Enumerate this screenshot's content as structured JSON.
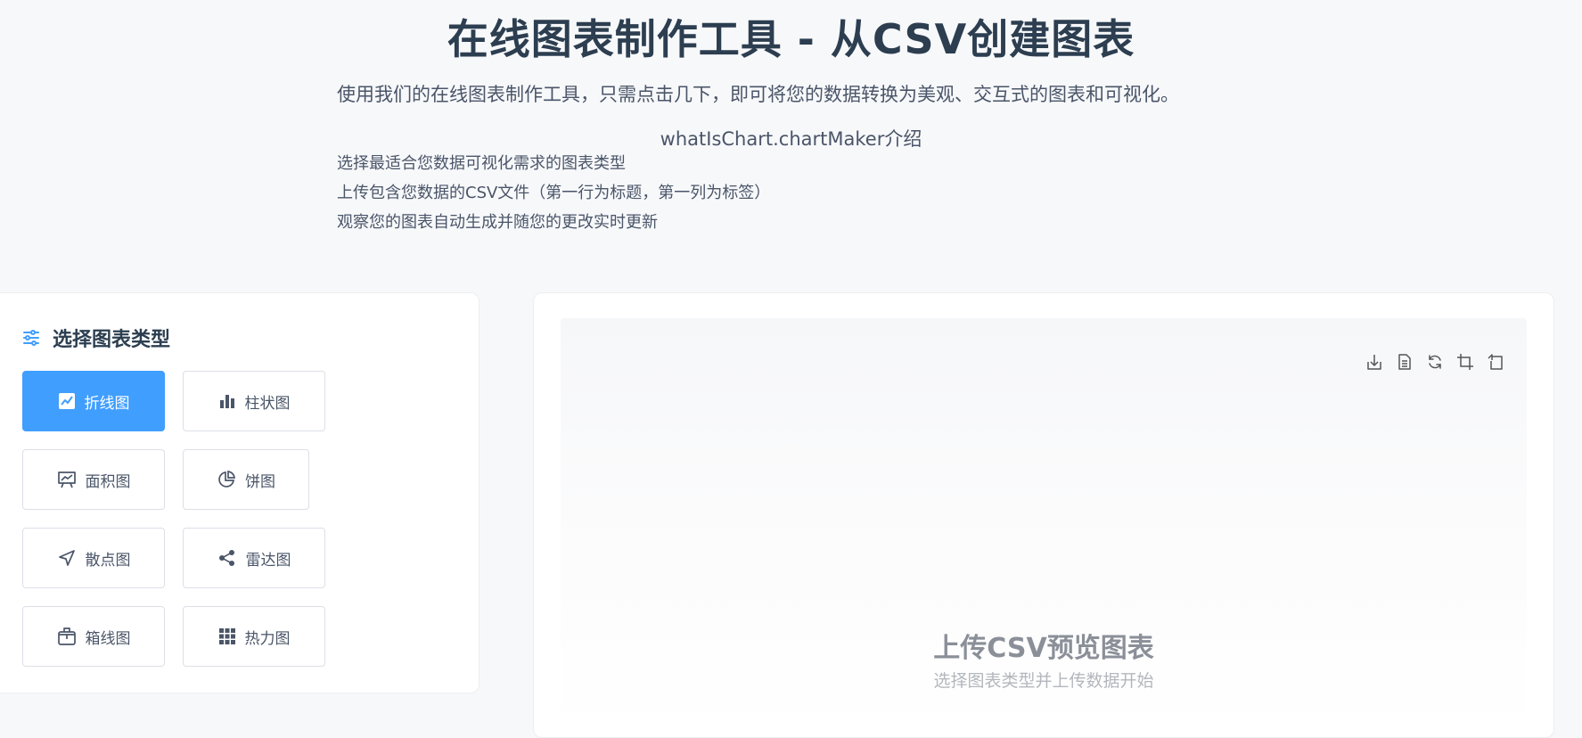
{
  "header": {
    "title": "在线图表制作工具 - 从CSV创建图表",
    "subtitle": "使用我们的在线图表制作工具，只需点击几下，即可将您的数据转换为美观、交互式的图表和可视化。",
    "intro_heading": "whatIsChart.chartMaker介绍",
    "steps": [
      "选择最适合您数据可视化需求的图表类型",
      "上传包含您数据的CSV文件（第一行为标题，第一列为标签）",
      "观察您的图表自动生成并随您的更改实时更新"
    ]
  },
  "chart_types_panel": {
    "title": "选择图表类型",
    "icon": "sliders-icon",
    "selected": "折线图",
    "types": [
      {
        "label": "折线图",
        "icon": "line-chart-icon",
        "active": true
      },
      {
        "label": "柱状图",
        "icon": "bar-chart-icon",
        "active": false
      },
      {
        "label": "面积图",
        "icon": "area-chart-icon",
        "active": false
      },
      {
        "label": "饼图",
        "icon": "pie-chart-icon",
        "active": false
      },
      {
        "label": "散点图",
        "icon": "scatter-icon",
        "active": false
      },
      {
        "label": "雷达图",
        "icon": "radar-share-icon",
        "active": false
      },
      {
        "label": "箱线图",
        "icon": "boxplot-icon",
        "active": false
      },
      {
        "label": "热力图",
        "icon": "heatmap-grid-icon",
        "active": false
      }
    ]
  },
  "preview": {
    "placeholder_title": "上传CSV预览图表",
    "placeholder_subtitle": "选择图表类型并上传数据开始",
    "toolbox": [
      "save-image-icon",
      "data-view-icon",
      "restore-icon",
      "zoom-icon",
      "zoom-reset-icon"
    ]
  },
  "colors": {
    "accent": "#409eff",
    "title": "#2c3e50",
    "text": "#4a5568",
    "background": "#f7f8fa"
  }
}
